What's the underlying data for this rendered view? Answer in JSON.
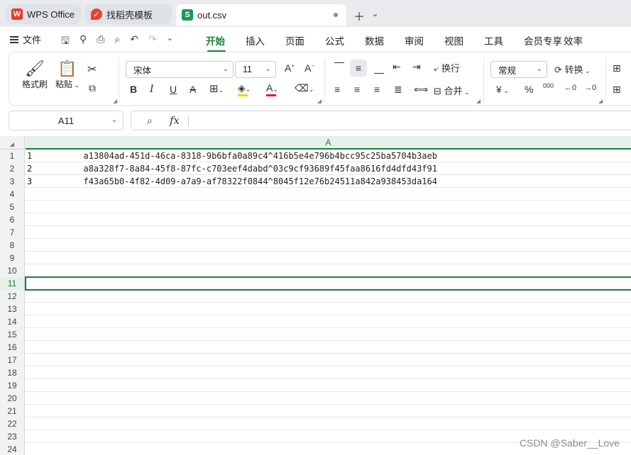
{
  "tabs": [
    {
      "label": "WPS Office",
      "icon": "wps-logo-icon"
    },
    {
      "label": "找稻壳模板",
      "icon": "docer-logo-icon"
    },
    {
      "label": "out.csv",
      "icon": "spreadsheet-s-icon",
      "logo_letter": "S"
    }
  ],
  "menu": {
    "file_label": "文件",
    "ribbon_tabs": [
      "开始",
      "插入",
      "页面",
      "公式",
      "数据",
      "审阅",
      "视图",
      "工具",
      "会员专享",
      "效率"
    ],
    "active_tab": "开始"
  },
  "ribbon": {
    "format_painter_label": "格式刷",
    "paste_label": "粘贴",
    "font_name": "宋体",
    "font_size": "11",
    "wrap_label": "换行",
    "merge_label": "合并",
    "number_format": "常规",
    "convert_label": "转换",
    "bold": "B",
    "italic": "I",
    "underline": "U",
    "strike": "A",
    "font_color_glyph": "A",
    "currency_glyph": "¥",
    "percent_glyph": "%",
    "thousands_glyph": "000",
    "font_color_accent": "#e02020",
    "fill_color_accent": "#f5d300"
  },
  "formula_bar": {
    "name_box": "A11",
    "fx_label": "fx",
    "value": ""
  },
  "sheet": {
    "column_header": "A",
    "corner_glyph": "◢",
    "accent_color": "#1a7f3c",
    "selected_row": 11,
    "rows": [
      {
        "num": "1",
        "value": "1          a13804ad-451d-46ca-8318-9b6bfa0a89c4^416b5e4e796b4bcc95c25ba5704b3aeb"
      },
      {
        "num": "2",
        "value": "2          a8a328f7-8a84-45f8-87fc-c703eef4dabd^03c9cf93689f45faa8616fd4dfd43f91"
      },
      {
        "num": "3",
        "value": "3          f43a65b0-4f82-4d09-a7a9-af78322f0844^8045f12e76b24511a842a938453da164"
      },
      {
        "num": "4",
        "value": ""
      },
      {
        "num": "5",
        "value": ""
      },
      {
        "num": "6",
        "value": ""
      },
      {
        "num": "7",
        "value": ""
      },
      {
        "num": "8",
        "value": ""
      },
      {
        "num": "9",
        "value": ""
      },
      {
        "num": "10",
        "value": ""
      },
      {
        "num": "11",
        "value": ""
      },
      {
        "num": "12",
        "value": ""
      },
      {
        "num": "13",
        "value": ""
      },
      {
        "num": "14",
        "value": ""
      },
      {
        "num": "15",
        "value": ""
      },
      {
        "num": "16",
        "value": ""
      },
      {
        "num": "17",
        "value": ""
      },
      {
        "num": "18",
        "value": ""
      },
      {
        "num": "19",
        "value": ""
      },
      {
        "num": "20",
        "value": ""
      },
      {
        "num": "21",
        "value": ""
      },
      {
        "num": "22",
        "value": ""
      },
      {
        "num": "23",
        "value": ""
      },
      {
        "num": "24",
        "value": ""
      }
    ]
  },
  "watermark": "CSDN @Saber__Love"
}
